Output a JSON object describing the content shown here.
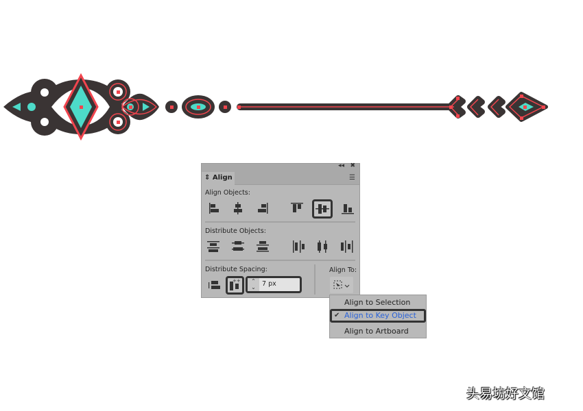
{
  "panel": {
    "title": "Align",
    "collapse_icon": "double-chevron-left",
    "close_icon": "x",
    "align_objects_label": "Align Objects:",
    "distribute_objects_label": "Distribute Objects:",
    "distribute_spacing_label": "Distribute Spacing:",
    "align_to_label": "Align To:",
    "spacing_value": "7 px"
  },
  "align_to_menu": {
    "items": [
      {
        "label": "Align to Selection",
        "checked": false
      },
      {
        "label": "Align to Key Object",
        "checked": true
      },
      {
        "label": "Align to Artboard",
        "checked": false
      }
    ],
    "check": "✔"
  },
  "watermark": "头易坊好文馆",
  "colors": {
    "dark": "#3a3434",
    "red": "#f1454e",
    "teal": "#4ddbc9",
    "highlight": "#2a62d8"
  }
}
